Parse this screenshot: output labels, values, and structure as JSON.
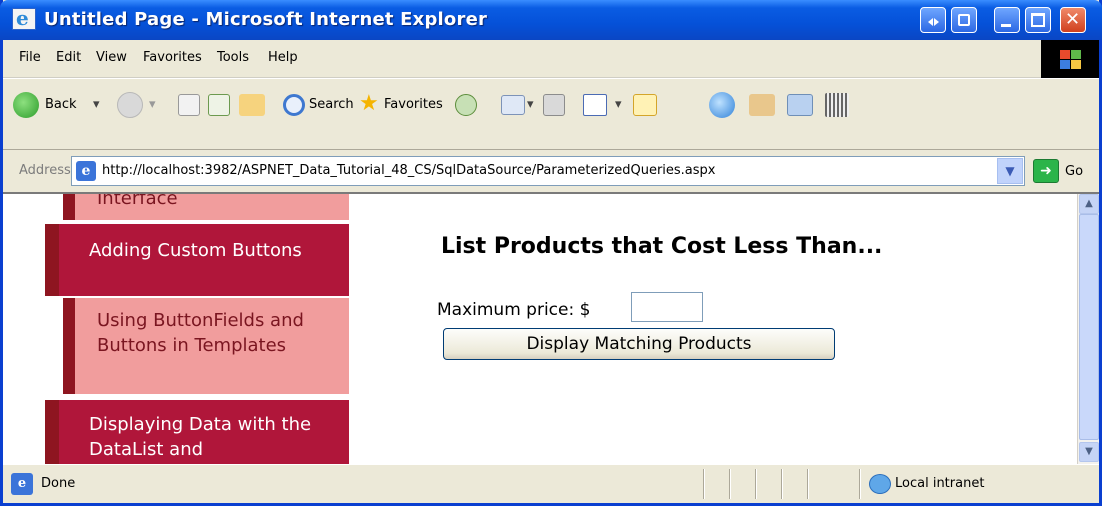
{
  "window": {
    "title": "Untitled Page - Microsoft Internet Explorer",
    "icon": "ie-logo-icon"
  },
  "menu": {
    "items": [
      "File",
      "Edit",
      "View",
      "Favorites",
      "Tools",
      "Help"
    ]
  },
  "toolbar": {
    "back_label": "Back",
    "search_label": "Search",
    "favorites_label": "Favorites"
  },
  "address": {
    "label": "Address",
    "url": "http://localhost:3982/ASPNET_Data_Tutorial_48_CS/SqlDataSource/ParameterizedQueries.aspx",
    "go_label": "Go"
  },
  "sidebar": {
    "items": [
      {
        "label": "Interface",
        "type": "sub"
      },
      {
        "label": "Adding Custom Buttons",
        "type": "main"
      },
      {
        "label": "Using ButtonFields and Buttons in Templates",
        "type": "sub"
      },
      {
        "label": "Displaying Data with the DataList and",
        "type": "main"
      }
    ]
  },
  "main": {
    "heading": "List Products that Cost Less Than...",
    "price_label": "Maximum price: $",
    "price_value": "",
    "button_label": "Display Matching Products"
  },
  "status": {
    "text": "Done",
    "zone": "Local intranet"
  },
  "colors": {
    "sidebar_main": "#b0163a",
    "sidebar_sub": "#f19d9d",
    "sidebar_accent": "#8e1520",
    "title_bar": "#0551d8"
  }
}
